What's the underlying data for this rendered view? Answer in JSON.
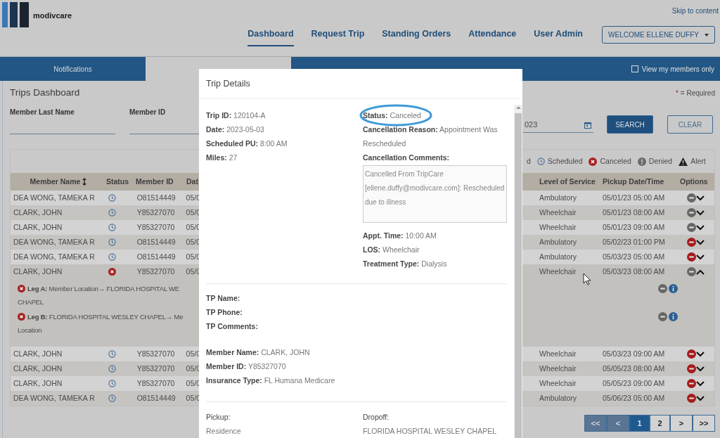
{
  "header": {
    "logo_text": "modivcare",
    "skip_link": "Skip to content",
    "nav": [
      {
        "label": "Dashboard",
        "selected": true
      },
      {
        "label": "Request Trip",
        "selected": false
      },
      {
        "label": "Standing Orders",
        "selected": false
      },
      {
        "label": "Attendance",
        "selected": false
      },
      {
        "label": "User Admin",
        "selected": false
      }
    ],
    "user_menu": "WELCOME ELLENE DUFFY"
  },
  "tabs": [
    {
      "label": "Notifications",
      "selected": false
    },
    {
      "selected": true
    }
  ],
  "my_members_only": {
    "label": "View my members only",
    "checked": false
  },
  "dashboard": {
    "title": "Trips Dashboard",
    "required_note": "= Required",
    "required_mark": "*",
    "fields": [
      {
        "label": "Member Last Name"
      },
      {
        "label": "Member ID"
      }
    ],
    "date_field": {
      "value": "023"
    },
    "search_button": "SEARCH",
    "clear_button": "CLEAR"
  },
  "legend": [
    {
      "kind": "cut",
      "label": "d"
    },
    {
      "kind": "scheduled",
      "label": "Scheduled"
    },
    {
      "kind": "canceled",
      "label": "Canceled"
    },
    {
      "kind": "denied",
      "label": "Denied"
    },
    {
      "kind": "alert",
      "label": "Alert"
    }
  ],
  "table": {
    "columns_left": [
      "Member Name",
      "Status",
      "Member ID",
      "Dat"
    ],
    "columns_right": [
      "Level of Service",
      "Pickup Date/Time",
      "Options"
    ],
    "rows": [
      {
        "name": "DEA WONG, TAMEKA R",
        "kind": "scheduled",
        "member_id": "O81514449",
        "date": "05/0",
        "los": "Ambulatory",
        "pickup": "05/01/23 05:00 AM",
        "cancel_enabled": false,
        "expanded": false
      },
      {
        "name": "CLARK, JOHN",
        "kind": "scheduled",
        "member_id": "Y85327070",
        "date": "05/0",
        "los": "Wheelchair",
        "pickup": "05/01/23 08:00 AM",
        "cancel_enabled": false,
        "expanded": false
      },
      {
        "name": "CLARK, JOHN",
        "kind": "scheduled",
        "member_id": "Y85327070",
        "date": "05/0",
        "los": "Wheelchair",
        "pickup": "05/01/23 09:00 AM",
        "cancel_enabled": false,
        "expanded": false
      },
      {
        "name": "DEA WONG, TAMEKA R",
        "kind": "scheduled",
        "member_id": "O81514449",
        "date": "05/0",
        "los": "Ambulatory",
        "pickup": "05/02/23 01:00 PM",
        "cancel_enabled": true,
        "expanded": false
      },
      {
        "name": "DEA WONG, TAMEKA R",
        "kind": "scheduled",
        "member_id": "O81514449",
        "date": "05/0",
        "los": "Ambulatory",
        "pickup": "05/03/23 05:00 AM",
        "cancel_enabled": true,
        "expanded": false
      },
      {
        "name": "CLARK, JOHN",
        "kind": "canceled",
        "member_id": "Y85327070",
        "date": "05/0",
        "los": "Wheelchair",
        "pickup": "05/03/23 08:00 AM",
        "cancel_enabled": false,
        "expanded": true,
        "legs": [
          {
            "label": "Leg A:",
            "text": "Member Location→ FLORIDA HOSPITAL WE",
            "continuation": "CHAPEL"
          },
          {
            "label": "Leg B:",
            "text": "FLORIDA HOSPITAL WESLEY CHAPEL→ Me",
            "continuation": "Location"
          }
        ]
      },
      {
        "name": "CLARK, JOHN",
        "kind": "scheduled",
        "member_id": "Y85327070",
        "date": "05/0",
        "los": "Wheelchair",
        "pickup": "05/03/23 09:00 AM",
        "cancel_enabled": true,
        "expanded": false
      },
      {
        "name": "CLARK, JOHN",
        "kind": "scheduled",
        "member_id": "Y85327070",
        "date": "05/0",
        "los": "Wheelchair",
        "pickup": "05/05/23 08:00 AM",
        "cancel_enabled": true,
        "expanded": false
      },
      {
        "name": "CLARK, JOHN",
        "kind": "scheduled",
        "member_id": "Y85327070",
        "date": "05/0",
        "los": "Wheelchair",
        "pickup": "05/05/23 09:00 AM",
        "cancel_enabled": true,
        "expanded": false
      },
      {
        "name": "DEA WONG, TAMEKA R",
        "kind": "scheduled",
        "member_id": "O81514449",
        "date": "05/0",
        "los": "Ambulatory",
        "pickup": "05/06/23 05:00 AM",
        "cancel_enabled": true,
        "expanded": false
      }
    ]
  },
  "pagination": [
    {
      "label": "<<",
      "selected": false,
      "disabled": true
    },
    {
      "label": "<",
      "selected": false,
      "disabled": true
    },
    {
      "label": "1",
      "selected": true,
      "disabled": false
    },
    {
      "label": "2",
      "selected": false,
      "disabled": false
    },
    {
      "label": ">",
      "selected": false,
      "disabled": false
    },
    {
      "label": ">>",
      "selected": false,
      "disabled": false
    }
  ],
  "modal": {
    "title": "Trip Details",
    "trip_left": [
      {
        "label": "Trip ID:",
        "value": "120104-A"
      },
      {
        "label": "Date:",
        "value": "2023-05-03"
      },
      {
        "label": "Scheduled PU:",
        "value": "8:00 AM"
      },
      {
        "label": "Miles:",
        "value": "27"
      }
    ],
    "trip_right": [
      {
        "label": "Status:",
        "value": "Canceled",
        "highlighted": true
      },
      {
        "label": "Cancellation Reason:",
        "value": "Appointment Was Rescheduled",
        "highlighted": false
      }
    ],
    "comments_label": "Cancellation Comments:",
    "comments": "Cancelled From TripCare [ellene.duffy@modivcare.com]: Rescheduled due to illness",
    "trip_right_more": [
      {
        "label": "Appt. Time:",
        "value": "10:00 AM"
      },
      {
        "label": "LOS:",
        "value": "Wheelchair"
      },
      {
        "label": "Treatment Type:",
        "value": "Dialysis"
      }
    ],
    "tp": [
      {
        "label": "TP Name:"
      },
      {
        "label": "TP Phone:"
      },
      {
        "label": "TP Comments:"
      }
    ],
    "member": [
      {
        "label": "Member Name:",
        "value": "CLARK, JOHN"
      },
      {
        "label": "Member ID:",
        "value": "Y85327070"
      },
      {
        "label": "Insurance Type:",
        "value": "FL Humana Medicare"
      }
    ],
    "pickup": {
      "label": "Pickup:",
      "value": "Residence"
    },
    "dropoff": {
      "label": "Dropoff:",
      "value": "FLORIDA HOSPITAL WESLEY CHAPEL"
    }
  }
}
